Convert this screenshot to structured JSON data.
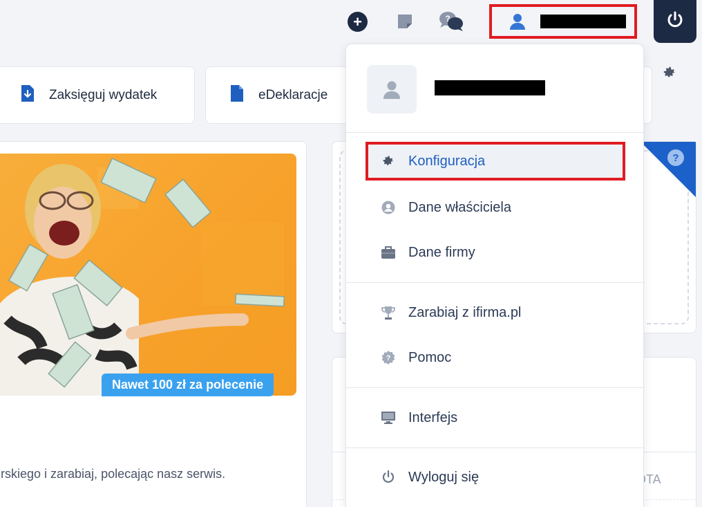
{
  "topbar": {
    "add_icon": "plus-circle-icon",
    "notes_icon": "sticky-note-icon",
    "chat_icon": "help-chat-icon",
    "user_icon": "user-icon",
    "power_icon": "power-icon"
  },
  "shortcuts": [
    {
      "label": "Zaksięguj wydatek",
      "icon": "document-download-icon"
    },
    {
      "label": "eDeklaracje",
      "icon": "document-icon"
    }
  ],
  "promo": {
    "badge": "Nawet 100 zł za polecenie",
    "text": "rskiego i zarabiaj, polecając nasz serwis."
  },
  "right_panel": {
    "help_badge": "?",
    "column_fragment": "OTA"
  },
  "menu": {
    "items": [
      {
        "label": "Konfiguracja",
        "icon": "gear-icon"
      },
      {
        "label": "Dane właściciela",
        "icon": "user-circle-icon"
      },
      {
        "label": "Dane firmy",
        "icon": "briefcase-icon"
      },
      {
        "label": "Zarabiaj z ifirma.pl",
        "icon": "trophy-icon"
      },
      {
        "label": "Pomoc",
        "icon": "help-badge-icon"
      },
      {
        "label": "Interfejs",
        "icon": "monitor-icon"
      },
      {
        "label": "Wyloguj się",
        "icon": "power-icon"
      }
    ]
  },
  "colors": {
    "accent": "#1f5fbf",
    "highlight_border": "#e11b22",
    "dark_navy": "#1d2a44"
  }
}
